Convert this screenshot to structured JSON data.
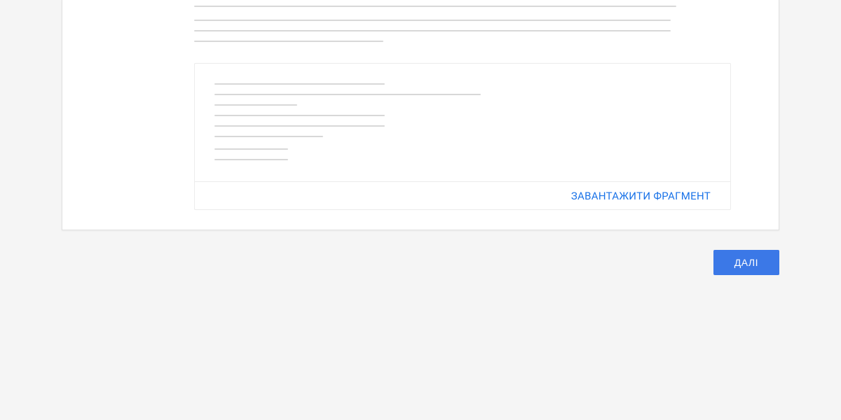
{
  "snippet": {
    "download_label": "ЗАВАНТАЖИТИ ФРАГМЕНТ"
  },
  "actions": {
    "next_label": "ДАЛІ"
  }
}
